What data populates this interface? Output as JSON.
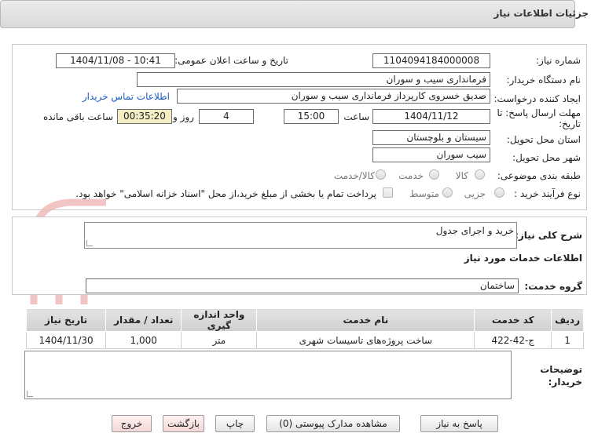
{
  "header": {
    "title": "جزئیات اطلاعات نیاز"
  },
  "form": {
    "need_number_label": "شماره نیاز:",
    "need_number": "1104094184000008",
    "announce_label": "تاریخ و ساعت اعلان عمومی:",
    "announce_value": "1404/11/08 - 10:41",
    "buyer_org_label": "نام دستگاه خریدار:",
    "buyer_org": "فرمانداری سیب و سوران",
    "creator_label": "ایجاد کننده درخواست:",
    "creator": "صدیق خسروی کارپرداز فرمانداری سیب و سوران",
    "contact_link": "اطلاعات تماس خریدار",
    "deadline_label_1": "مهلت ارسال پاسخ: تا",
    "deadline_label_2": "تاریخ:",
    "deadline_date": "1404/11/12",
    "time_label": "ساعت",
    "deadline_time": "15:00",
    "days_value": "4",
    "days_label": "روز و",
    "remaining_time": "00:35:20",
    "remaining_label": "ساعت باقی مانده",
    "province_label": "استان محل تحویل:",
    "province": "سیستان و بلوچستان",
    "city_label": "شهر محل تحویل:",
    "city": "سیب سوران",
    "category_label": "طبقه بندی موضوعی:",
    "category_options": [
      "کالا",
      "خدمت",
      "کالا/خدمت"
    ],
    "process_label": "نوع فرآیند خرید :",
    "process_options": [
      "جزیی",
      "متوسط"
    ],
    "payment_note": "پرداخت تمام یا بخشی از مبلغ خرید،از محل \"اسناد خزانه اسلامی\" خواهد بود."
  },
  "summary": {
    "label": "شرح کلی نیاز:",
    "value": "خرید و اجرای جدول"
  },
  "services": {
    "section_title": "اطلاعات خدمات مورد نیاز",
    "group_label": "گروه خدمت:",
    "group_value": "ساختمان",
    "columns": [
      "ردیف",
      "کد خدمت",
      "نام خدمت",
      "واحد اندازه گیری",
      "تعداد / مقدار",
      "تاریخ نیاز"
    ],
    "rows": [
      {
        "index": "1",
        "code": "ج-42-422",
        "name": "ساخت پروژه‌های تاسیسات شهری",
        "unit": "متر",
        "qty": "1,000",
        "date": "1404/11/30"
      }
    ]
  },
  "buyer_notes": {
    "label_1": "توضیحات",
    "label_2": "خریدار:"
  },
  "buttons": {
    "reply": "پاسخ به نیاز",
    "attachments": "مشاهده مدارک پیوستی (0)",
    "print": "چاپ",
    "back": "بازگشت",
    "exit": "خروج"
  },
  "watermark": {
    "text": "AriaTender.net"
  },
  "colors": {
    "link": "#1a5cc8",
    "remaining_bg": "#f2edc4",
    "watermark": "#e8a3a3"
  }
}
